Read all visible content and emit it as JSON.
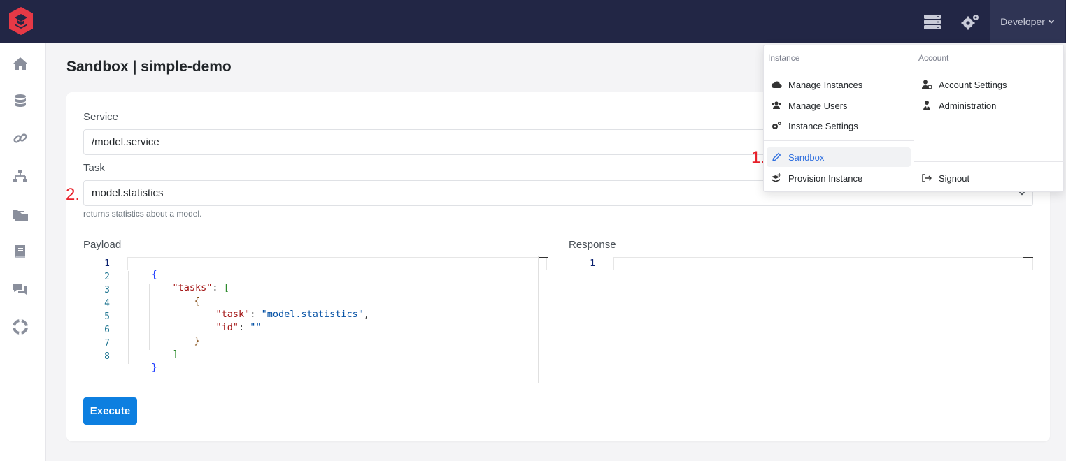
{
  "header": {
    "developer_label": "Developer",
    "caret": "⌄"
  },
  "page": {
    "title": "Sandbox | simple-demo"
  },
  "form": {
    "service_label": "Service",
    "service_value": "/model.service",
    "task_label": "Task",
    "task_value": "model.statistics",
    "task_hint": "returns statistics about a model.",
    "payload_label": "Payload",
    "response_label": "Response",
    "execute_label": "Execute"
  },
  "payload_editor": {
    "line_numbers": [
      "1",
      "2",
      "3",
      "4",
      "5",
      "6",
      "7",
      "8"
    ],
    "lines": [
      "{",
      "\"tasks\"",
      ": ",
      "[",
      "{",
      "\"task\"",
      ": ",
      "\"model.statistics\"",
      ",",
      "\"id\"",
      ": ",
      "\"\"",
      "}",
      "]",
      "}"
    ]
  },
  "response_editor": {
    "line_numbers": [
      "1"
    ]
  },
  "annotations": {
    "step1": "1.",
    "step2": "2."
  },
  "menu": {
    "instance_header": "Instance",
    "account_header": "Account",
    "instance_items": [
      {
        "label": "Manage Instances",
        "icon": "cloud-icon"
      },
      {
        "label": "Manage Users",
        "icon": "users-icon"
      },
      {
        "label": "Instance Settings",
        "icon": "gears-icon"
      }
    ],
    "sandbox": {
      "label": "Sandbox",
      "icon": "pencil-icon"
    },
    "provision": {
      "label": "Provision Instance",
      "icon": "layers-add-icon"
    },
    "account_items": [
      {
        "label": "Account Settings",
        "icon": "user-gear-icon"
      },
      {
        "label": "Administration",
        "icon": "user-tie-icon"
      }
    ],
    "signout": {
      "label": "Signout",
      "icon": "sign-out-icon"
    }
  },
  "sidebar_icons": [
    "home-icon",
    "database-icon",
    "link-icon",
    "sitemap-icon",
    "folders-icon",
    "book-icon",
    "comments-icon",
    "lifebuoy-icon"
  ],
  "colors": {
    "topbar": "#222645",
    "accent": "#0d7fe0",
    "logo": "#e63946",
    "annotation": "#e8202a",
    "active_link": "#2f6fdf"
  }
}
